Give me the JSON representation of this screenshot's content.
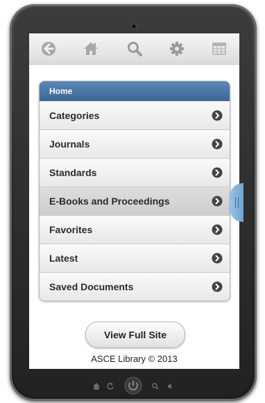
{
  "toolbar": {
    "icons": [
      "back-icon",
      "home-icon",
      "search-icon",
      "settings-icon",
      "grid-icon"
    ]
  },
  "menu": {
    "header": "Home",
    "items": [
      {
        "label": "Categories"
      },
      {
        "label": "Journals"
      },
      {
        "label": "Standards"
      },
      {
        "label": "E-Books and Proceedings",
        "active": true
      },
      {
        "label": "Favorites"
      },
      {
        "label": "Latest"
      },
      {
        "label": "Saved Documents"
      }
    ]
  },
  "footer": {
    "full_site_label": "View Full Site",
    "copyright": "ASCE Library © 2013"
  },
  "colors": {
    "header_blue": "#3a6796",
    "handle_blue": "#6fa3cf",
    "icon_gray": "#9a9a9a"
  }
}
